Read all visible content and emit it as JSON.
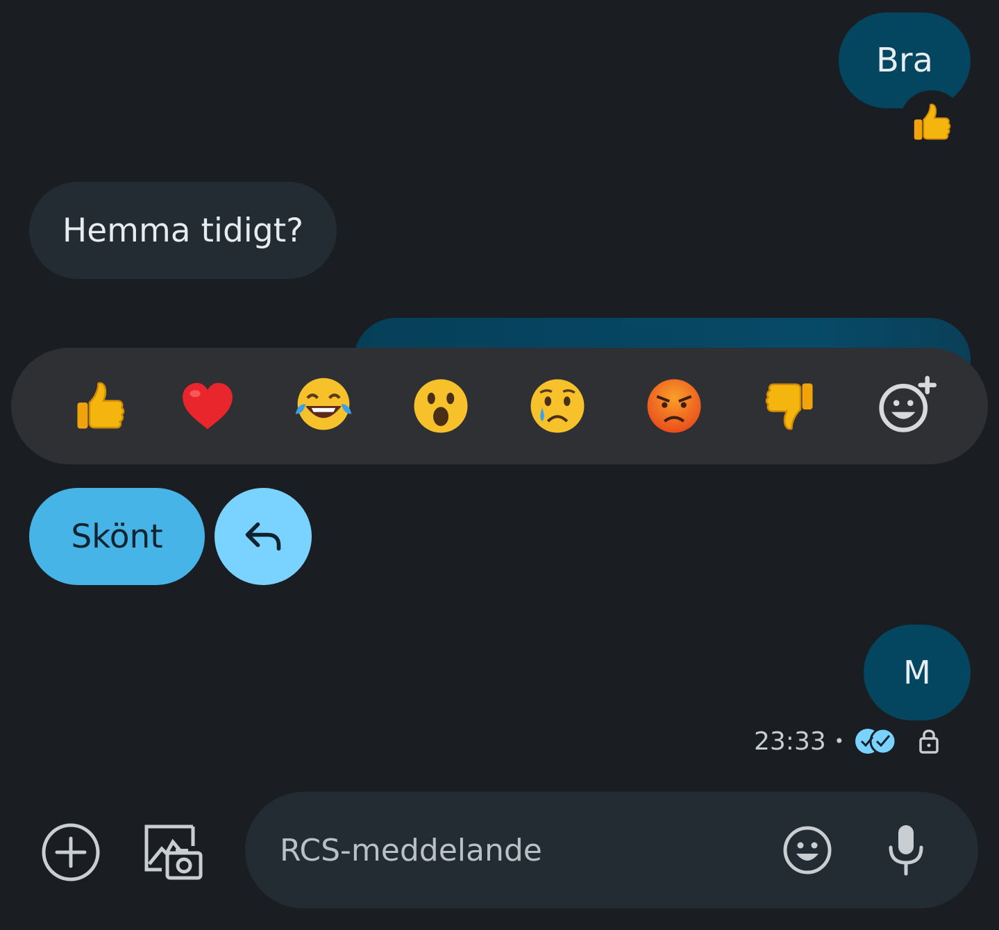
{
  "conversation": {
    "messages": [
      {
        "direction": "outgoing",
        "text": "Bra",
        "reaction": "thumbs-up"
      },
      {
        "direction": "incoming",
        "text": "Hemma tidigt?"
      },
      {
        "direction": "outgoing",
        "text": ""
      },
      {
        "direction": "outgoing",
        "text": "M"
      }
    ],
    "last_message_time": "23:33",
    "meta_separator": "•",
    "delivery_status": "read",
    "encrypted": true
  },
  "reaction_bar": {
    "emojis": [
      "thumbs-up",
      "red-heart",
      "face-with-tears-of-joy",
      "face-with-open-mouth",
      "crying-face",
      "angry-face",
      "thumbs-down",
      "add-reaction"
    ]
  },
  "suggestions": {
    "chip_label": "Skönt",
    "reply_icon": "reply-arrow-icon"
  },
  "compose": {
    "placeholder": "RCS-meddelande",
    "value": ""
  },
  "colors": {
    "background": "#1a1d21",
    "outgoing_bubble": "#04465f",
    "incoming_bubble": "#242c33",
    "reaction_bar": "#2e3034",
    "chip": "#46b4e6",
    "reply_chip": "#7ad3ff",
    "read_indicator": "#7ad3ff"
  }
}
